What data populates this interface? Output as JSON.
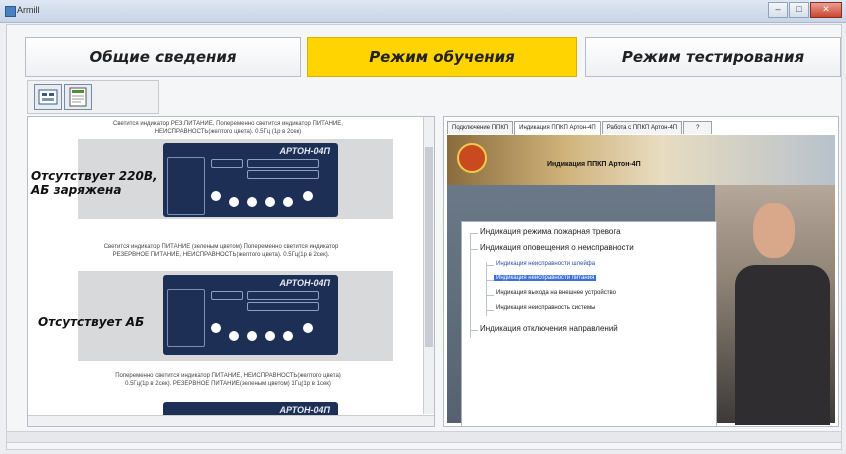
{
  "window": {
    "title": "Armill",
    "min": "–",
    "max": "□",
    "close": "✕"
  },
  "modes": [
    {
      "label": "Общие сведения"
    },
    {
      "label": "Режим обучения"
    },
    {
      "label": "Режим тестирования"
    }
  ],
  "toolbar": {
    "icons": [
      "layout-view-icon",
      "document-view-icon"
    ]
  },
  "left": {
    "captions": [
      "Светится индикатор РЕЗ.ПИТАНИЕ. Попеременно светится индикатор ПИТАНИЕ,",
      "НЕИСПРАВНОСТЬ(желтого цвета). 0.5Гц (1р в 2сек)",
      "Светится индикатор ПИТАНИЕ (зеленым цветом) Попеременно светится индикатор",
      "РЕЗЕРВНОЕ ПИТАНИЕ, НЕИСПРАВНОСТЬ(желтого цвета). 0.5Гц(1р в 2сек).",
      "Попеременно светится индикатор ПИТАНИЕ, НЕИСПРАВНОСТЬ(желтого цвета)",
      "0.5Гц(1р в 2сек). РЕЗЕРВНОЕ ПИТАНИЕ(зеленым цветом) 1Гц(1р в 1сек)"
    ],
    "label1_line1": "Отсутствует 220В,",
    "label1_line2": "АБ заряжена",
    "label2": "Отсутствует АБ",
    "panel_name": "АРТОН-04П"
  },
  "right": {
    "tabs": [
      "Подключение ППКП",
      "Индикация ППКП Артон-4П",
      "Работа с ППКП Артон-4П",
      "?"
    ],
    "banner_title": "Индикация ППКП Артон-4П",
    "tree": [
      "Индикация режима пожарная тревога",
      "Индикация оповещения о неисправности",
      "Индикация неисправности шлейфа",
      "Индикация неисправности питания",
      "Индикация выхода на внешнее устройство",
      "Индикация неисправность системы",
      "Индикация отключения направлений"
    ]
  },
  "colors": {
    "accent": "#ffd400",
    "panel": "#1d2f55",
    "selection": "#3a6fd8"
  }
}
